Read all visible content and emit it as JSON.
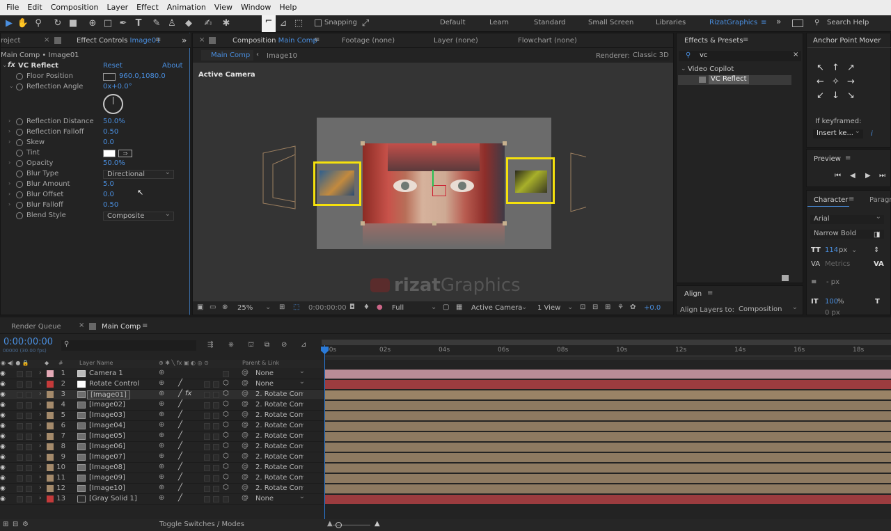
{
  "menu": [
    "File",
    "Edit",
    "Composition",
    "Layer",
    "Effect",
    "Animation",
    "View",
    "Window",
    "Help"
  ],
  "toolbar": {
    "snapping": "Snapping",
    "workspaces": [
      "Default",
      "Learn",
      "Standard",
      "Small Screen",
      "Libraries",
      "RizatGraphics"
    ],
    "more": "»",
    "search_help": "Search Help"
  },
  "project_tab": "roject",
  "effect_controls": {
    "tab_prefix": "Effect Controls",
    "tab_layer": "Image01",
    "breadcrumb": "Main Comp • Image01",
    "effect_name": "VC Reflect",
    "reset": "Reset",
    "about": "About",
    "properties": [
      {
        "name": "Floor Position",
        "value": "960.0,1080.0",
        "type": "point"
      },
      {
        "name": "Reflection Angle",
        "value": "0x+0.0°",
        "type": "angle"
      },
      {
        "name": "Reflection Distance",
        "value": "50.0%"
      },
      {
        "name": "Reflection Falloff",
        "value": "0.50"
      },
      {
        "name": "Skew",
        "value": "0.0"
      },
      {
        "name": "Tint",
        "value": "",
        "type": "color"
      },
      {
        "name": "Opacity",
        "value": "50.0%"
      },
      {
        "name": "Blur Type",
        "value": "Directional",
        "type": "dropdown"
      },
      {
        "name": "Blur Amount",
        "value": "5.0"
      },
      {
        "name": "Blur Offset",
        "value": "0.0"
      },
      {
        "name": "Blur Falloff",
        "value": "0.50"
      },
      {
        "name": "Blend Style",
        "value": "Composite",
        "type": "dropdown"
      }
    ]
  },
  "composition": {
    "tab_prefix": "Composition",
    "tab_name": "Main Comp",
    "footage_tab": "Footage  (none)",
    "layer_tab": "Layer  (none)",
    "flowchart_tab": "Flowchart  (none)",
    "subtabs": [
      "Main Comp",
      "Image10"
    ],
    "renderer_label": "Renderer:",
    "renderer_value": "Classic 3D",
    "view_label": "Active Camera",
    "watermark_bold": "rizat",
    "watermark_rest": "Graphics",
    "bottom": {
      "zoom": "25%",
      "timecode": "0:00:00:00",
      "resolution": "Full",
      "camera": "Active Camera",
      "views": "1 View",
      "exposure": "+0.0"
    }
  },
  "effects_presets": {
    "title": "Effects & Presets",
    "search_value": "vc",
    "category": "Video Copilot",
    "item": "VC Reflect"
  },
  "align": {
    "title": "Align",
    "align_to_label": "Align Layers to:",
    "align_to_value": "Composition"
  },
  "anchor_point": {
    "title": "Anchor Point Mover",
    "if_keyframed": "If keyframed:",
    "insert_value": "Insert ke..."
  },
  "preview": {
    "title": "Preview"
  },
  "character": {
    "title": "Character",
    "next_tab": "Paragra",
    "font": "Arial",
    "style": "Narrow Bold",
    "size": "114",
    "size_unit": "px",
    "tracking_label": "Metrics",
    "leading_unit": "- px",
    "vscale": "100",
    "vscale_unit": "%",
    "bottom_value": "0 px"
  },
  "timeline": {
    "render_queue": "Render Queue",
    "tab": "Main Comp",
    "timecode": "0:00:00:00",
    "fps": "00000 (30.00 fps)",
    "col_layer_name": "Layer Name",
    "col_parent": "Parent & Link",
    "toggle": "Toggle Switches / Modes",
    "ticks": [
      "00s",
      "02s",
      "04s",
      "06s",
      "08s",
      "10s",
      "12s",
      "14s",
      "16s",
      "18s"
    ],
    "layers": [
      {
        "num": "1",
        "name": "Camera 1",
        "label": "#e3a9b6",
        "parent": "None",
        "kind": "camera",
        "bar": "#b98c96"
      },
      {
        "num": "2",
        "name": "Rotate Control",
        "label": "#c43a3a",
        "parent": "None",
        "kind": "null",
        "bar": "#9c3c3f"
      },
      {
        "num": "3",
        "name": "[Image01]",
        "label": "#a48a6b",
        "parent": "2. Rotate Con",
        "kind": "image",
        "fx": true,
        "selected": true,
        "bar": "#9a8366"
      },
      {
        "num": "4",
        "name": "[Image02]",
        "label": "#a48a6b",
        "parent": "2. Rotate Con",
        "kind": "image",
        "bar": "#8e7a61"
      },
      {
        "num": "5",
        "name": "[Image03]",
        "label": "#a48a6b",
        "parent": "2. Rotate Con",
        "kind": "image",
        "bar": "#8e7a61"
      },
      {
        "num": "6",
        "name": "[Image04]",
        "label": "#a48a6b",
        "parent": "2. Rotate Con",
        "kind": "image",
        "bar": "#8e7a61"
      },
      {
        "num": "7",
        "name": "[Image05]",
        "label": "#a48a6b",
        "parent": "2. Rotate Con",
        "kind": "image",
        "bar": "#8e7a61"
      },
      {
        "num": "8",
        "name": "[Image06]",
        "label": "#a48a6b",
        "parent": "2. Rotate Con",
        "kind": "image",
        "bar": "#8e7a61"
      },
      {
        "num": "9",
        "name": "[Image07]",
        "label": "#a48a6b",
        "parent": "2. Rotate Con",
        "kind": "image",
        "bar": "#8e7a61"
      },
      {
        "num": "10",
        "name": "[Image08]",
        "label": "#a48a6b",
        "parent": "2. Rotate Con",
        "kind": "image",
        "bar": "#8e7a61"
      },
      {
        "num": "11",
        "name": "[Image09]",
        "label": "#a48a6b",
        "parent": "2. Rotate Con",
        "kind": "image",
        "bar": "#8e7a61"
      },
      {
        "num": "12",
        "name": "[Image10]",
        "label": "#a48a6b",
        "parent": "2. Rotate Con",
        "kind": "image",
        "bar": "#8e7a61"
      },
      {
        "num": "13",
        "name": "[Gray Solid 1]",
        "label": "#c43a3a",
        "parent": "None",
        "kind": "solid",
        "bar": "#9c3c3f"
      }
    ]
  },
  "colors": {
    "accent": "#4a8fe0",
    "highlight_box": "#f5e10d"
  }
}
